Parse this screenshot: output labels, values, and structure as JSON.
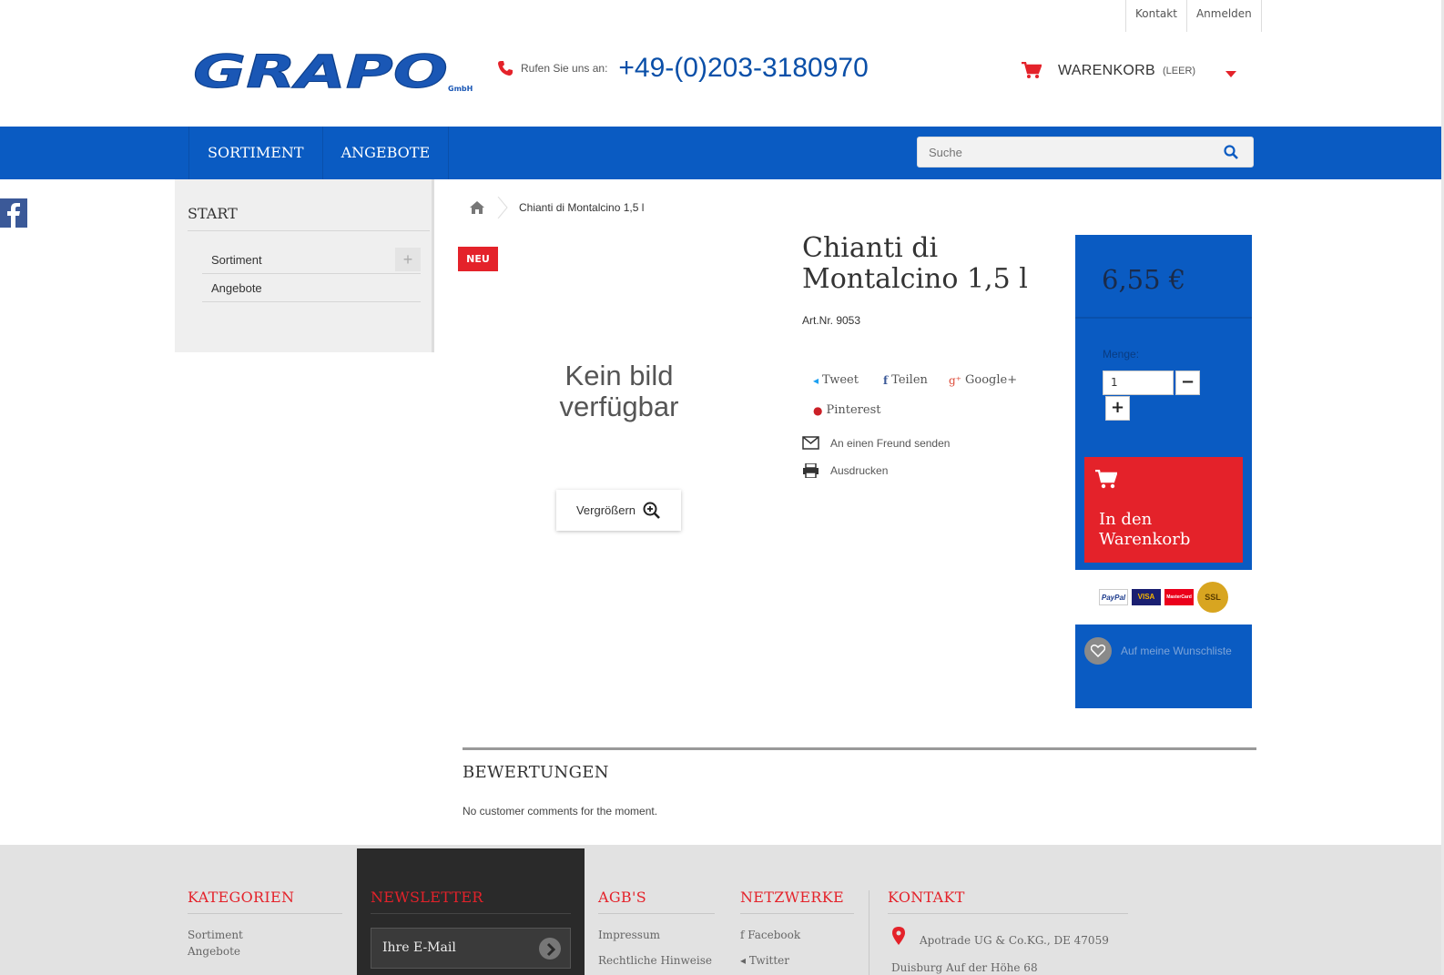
{
  "toplinks": {
    "kontakt": "Kontakt",
    "anmelden": "Anmelden"
  },
  "header": {
    "logo_text": "GRAPO",
    "logo_sub": "GmbH",
    "phone_label": "Rufen Sie uns an:",
    "phone_number": "+49-(0)203-3180970",
    "cart_label": "WARENKORB",
    "cart_status": "(LEER)"
  },
  "nav": {
    "items": [
      "SORTIMENT",
      "ANGEBOTE"
    ]
  },
  "search": {
    "placeholder": "Suche"
  },
  "sidebar": {
    "title": "START",
    "items": [
      {
        "label": "Sortiment",
        "expand": "+"
      },
      {
        "label": "Angebote"
      }
    ]
  },
  "breadcrumb": {
    "current": "Chianti di Montalcino 1,5 l"
  },
  "product": {
    "badge": "NEU",
    "no_image": "Kein bild verfügbar",
    "zoom_label": "Vergrößern",
    "title": "Chianti di Montalcino 1,5 l",
    "art_nr": "Art.Nr. 9053",
    "share": {
      "tweet": "Tweet",
      "teilen": "Teilen",
      "google": "Google+",
      "pinterest": "Pinterest"
    },
    "send_friend": "An einen Freund senden",
    "print": "Ausdrucken"
  },
  "buybox": {
    "price": "6,55 €",
    "menge_label": "Menge:",
    "qty": "1",
    "minus": "−",
    "plus": "+",
    "add_to_cart": "In den Warenkorb",
    "payments": [
      "PayPal",
      "VISA",
      "MasterCard",
      "SSL"
    ],
    "wishlist": "Auf meine Wunschliste"
  },
  "reviews": {
    "title": "BEWERTUNGEN",
    "empty": "No customer comments for the moment."
  },
  "footer": {
    "kategorien": {
      "title": "KATEGORIEN",
      "items": [
        "Sortiment",
        "Angebote"
      ]
    },
    "newsletter": {
      "title": "NEWSLETTER",
      "placeholder": "Ihre E-Mail"
    },
    "agb": {
      "title": "AGB'S",
      "items": [
        "Impressum",
        "Rechtliche Hinweise"
      ]
    },
    "netzwerke": {
      "title": "NETZWERKE",
      "items": [
        "Facebook",
        "Twitter"
      ]
    },
    "kontakt": {
      "title": "KONTAKT",
      "line1": "Apotrade UG & Co.KG., DE 47059",
      "line2": "Duisburg Auf der Höhe 68"
    }
  },
  "colors": {
    "brand_blue": "#0a5bc2",
    "accent_red": "#e4222a",
    "footer_bg": "#e2e2e2",
    "dark": "#2a2a2a"
  }
}
